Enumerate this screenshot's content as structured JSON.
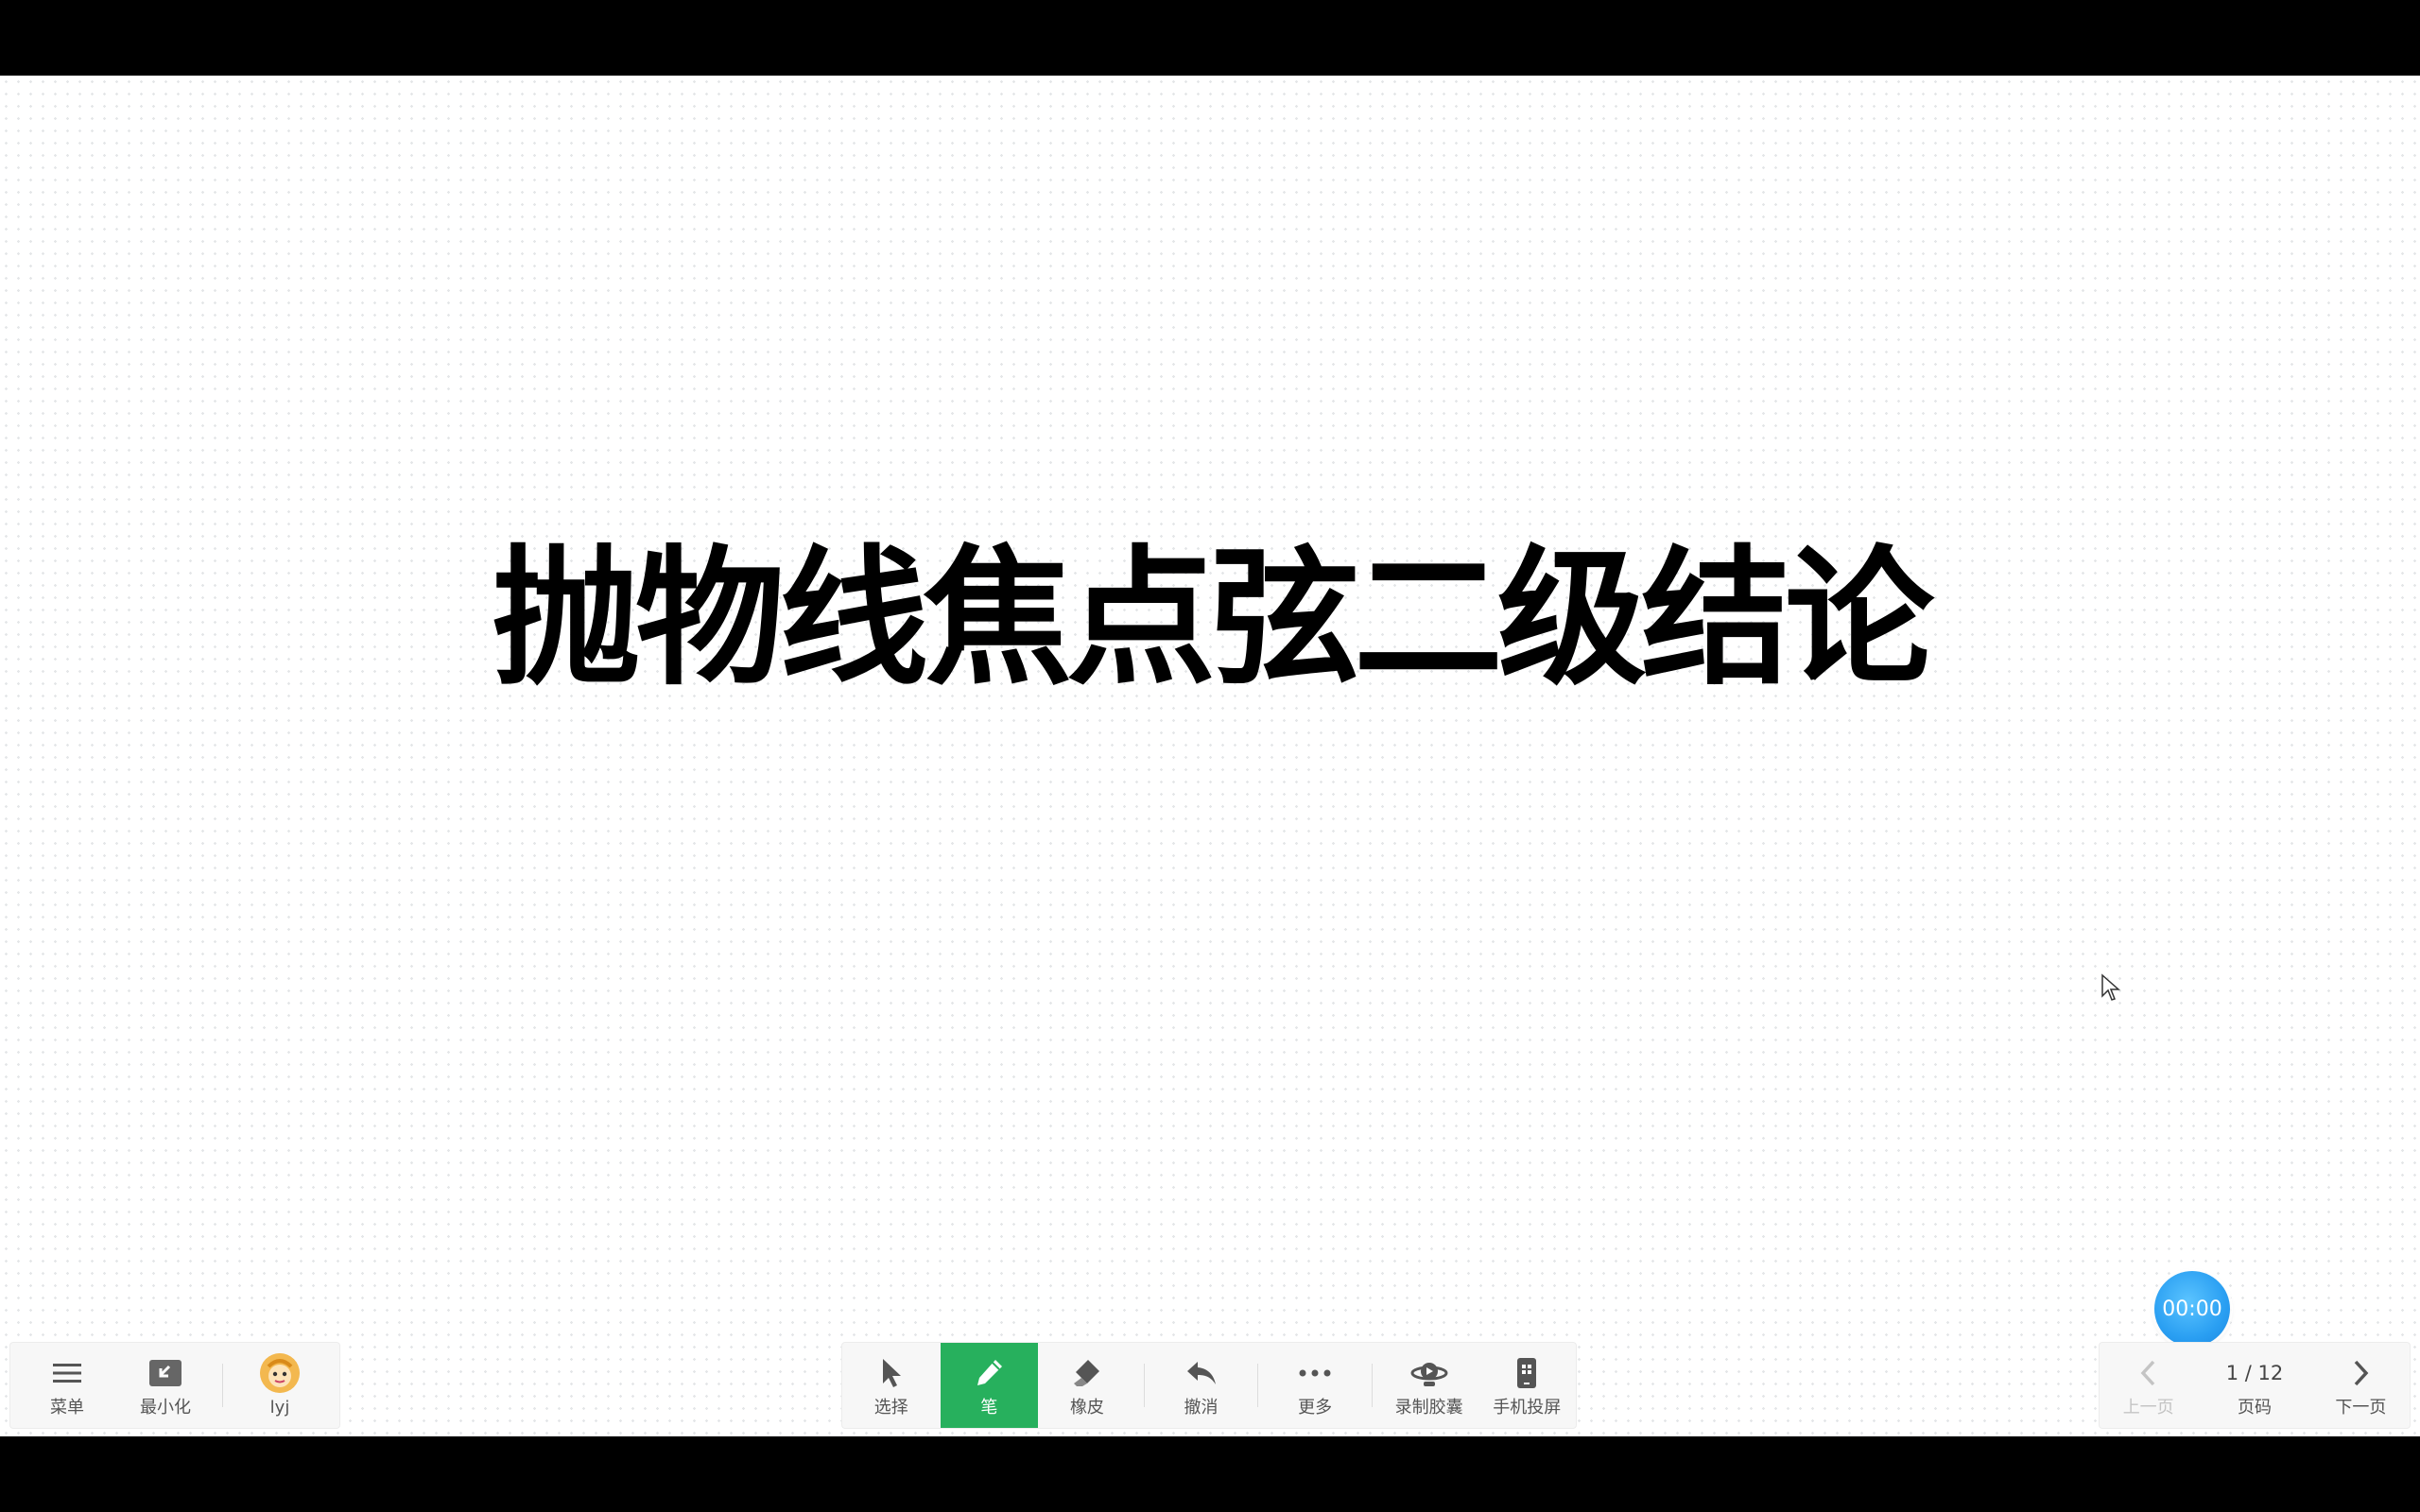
{
  "slide": {
    "title": "抛物线焦点弦二级结论"
  },
  "left_toolbar": {
    "menu_label": "菜单",
    "minimize_label": "最小化",
    "user_name": "lyj"
  },
  "center_toolbar": {
    "select_label": "选择",
    "pen_label": "笔",
    "eraser_label": "橡皮",
    "undo_label": "撤消",
    "more_label": "更多",
    "record_label": "录制胶囊",
    "phone_cast_label": "手机投屏"
  },
  "right_toolbar": {
    "prev_label": "上一页",
    "page_label": "页码",
    "page_indicator": "1 / 12",
    "next_label": "下一页"
  },
  "timer": {
    "value": "00:00"
  },
  "colors": {
    "active_tool": "#27b05d",
    "timer_blue": "#2a9ff2"
  }
}
